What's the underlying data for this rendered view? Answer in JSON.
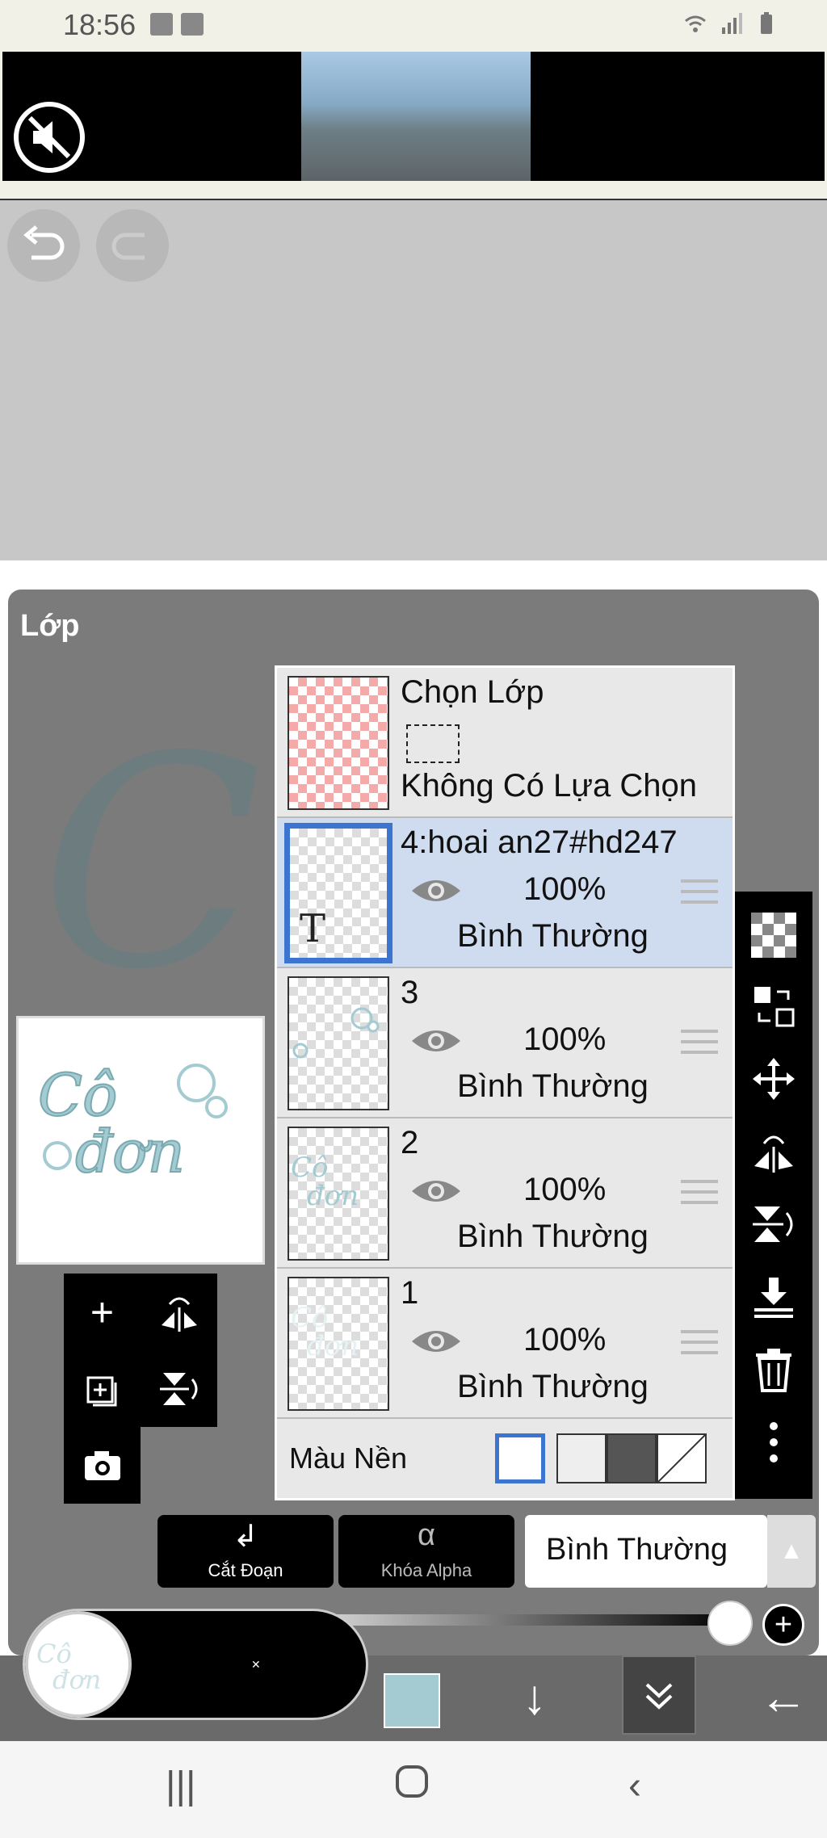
{
  "status_bar": {
    "time": "18:56",
    "icons": [
      "gallery-icon",
      "clock-icon",
      "wifi-icon",
      "signal-icon",
      "battery-icon"
    ]
  },
  "ad": {
    "mute_icon": "mute-icon"
  },
  "canvas": {
    "undo_icon": "undo-icon",
    "redo_icon": "redo-icon"
  },
  "layer_panel": {
    "title": "Lớp",
    "selection_layer": {
      "name": "Chọn Lớp",
      "status": "Không Có Lựa Chọn"
    },
    "layers": [
      {
        "name": "4:hoai an27#hd247",
        "opacity": "100%",
        "blend": "Bình Thường",
        "selected": true,
        "text_layer": true,
        "thumb_text": "T"
      },
      {
        "name": "3",
        "opacity": "100%",
        "blend": "Bình Thường",
        "selected": false
      },
      {
        "name": "2",
        "opacity": "100%",
        "blend": "Bình Thường",
        "selected": false
      },
      {
        "name": "1",
        "opacity": "100%",
        "blend": "Bình Thường",
        "selected": false
      }
    ],
    "background": {
      "label": "Màu Nền",
      "selected": "white"
    }
  },
  "preview": {
    "line1": "Cô",
    "line2": "đơn"
  },
  "bottom_controls": {
    "clip_label": "Cắt Đoạn",
    "alpha_label": "Khóa Alpha",
    "alpha_glyph": "α",
    "blend_mode": "Bình Thường",
    "opacity_slider": 1.0
  },
  "bottom_toolbar": {
    "color": "#a3cbd1"
  },
  "colors": {
    "accent": "#3c75d0",
    "panel": "#7b7b7b",
    "selected_row": "#cfdbee"
  }
}
